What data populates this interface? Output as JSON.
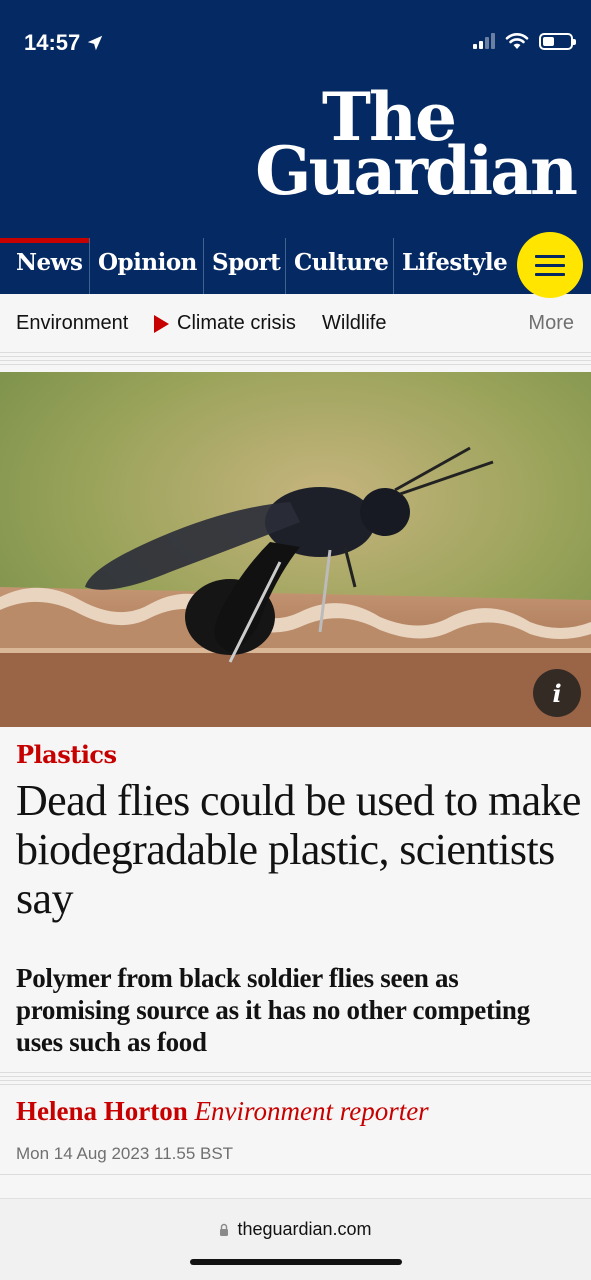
{
  "status_bar": {
    "time": "14:57",
    "icons": [
      "location-arrow-icon",
      "cellular-signal-icon",
      "wifi-icon",
      "battery-icon"
    ],
    "battery_level": 0.42
  },
  "masthead": {
    "logo_line1": "The",
    "logo_line2": "Guardian",
    "background_color": "#052962"
  },
  "nav": {
    "pillars": [
      {
        "label": "News",
        "active": true
      },
      {
        "label": "Opinion",
        "active": false
      },
      {
        "label": "Sport",
        "active": false
      },
      {
        "label": "Culture",
        "active": false
      },
      {
        "label": "Lifestyle",
        "active": false
      }
    ],
    "menu_icon": "hamburger-menu-icon",
    "menu_color": "#ffe500"
  },
  "subnav": {
    "items": [
      "Environment",
      "Climate crisis",
      "Wildlife"
    ],
    "more_label": "More"
  },
  "article": {
    "image_alt_icon": "info-icon",
    "image_info_label": "i",
    "kicker": "Plastics",
    "headline": "Dead flies could be used to make biodegradable plastic, scientists say",
    "standfirst": "Polymer from black soldier flies seen as promising source as it has no other competing uses such as food",
    "author": "Helena Horton",
    "author_role": "Environment reporter",
    "date": "Mon 14 Aug 2023 11.55 BST",
    "accent_color": "#c70000"
  },
  "browser": {
    "url": "theguardian.com",
    "lock_icon": "lock-icon"
  }
}
